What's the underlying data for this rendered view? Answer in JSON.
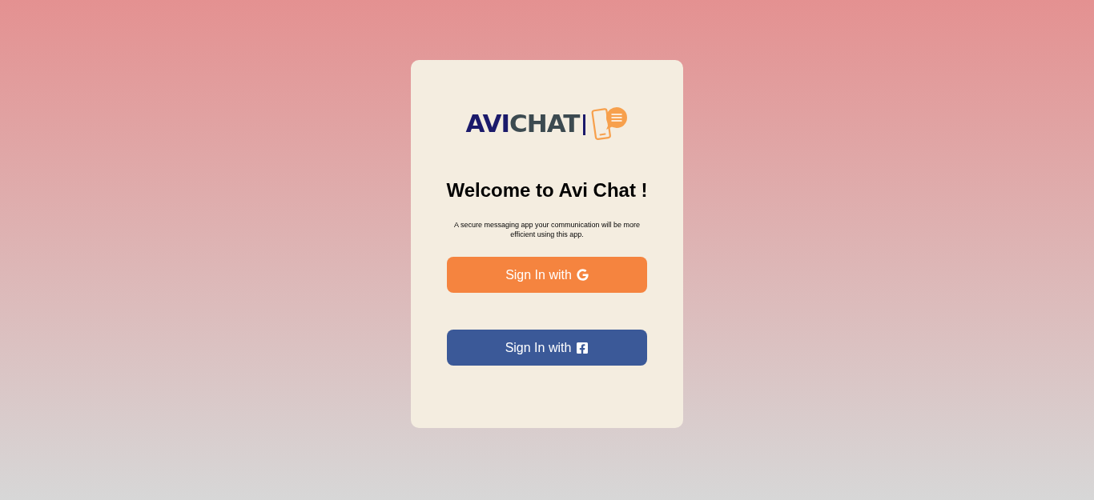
{
  "logo": {
    "words": [
      {
        "text": "AVI",
        "color": "#1b1a6b"
      },
      {
        "text": "CHAT",
        "color": "#3c4a50"
      }
    ]
  },
  "heading": "Welcome to Avi Chat !",
  "description": "A secure messaging app your communication will be more efficient using this app.",
  "buttons": [
    {
      "label": "Sign In with",
      "kind": "google"
    },
    {
      "label": "Sign In with",
      "kind": "facebook"
    }
  ]
}
